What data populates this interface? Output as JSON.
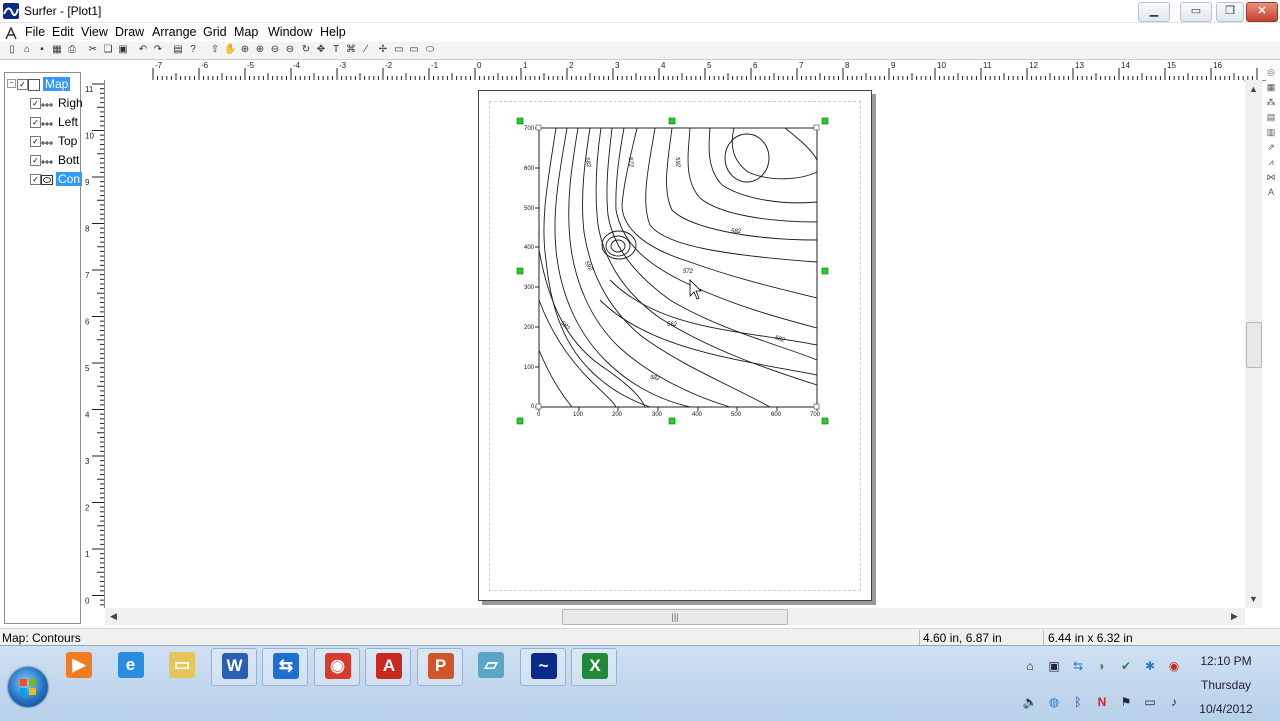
{
  "window": {
    "title": "Surfer - [Plot1]"
  },
  "menu": [
    "File",
    "Edit",
    "View",
    "Draw",
    "Arrange",
    "Grid",
    "Map",
    "Window",
    "Help"
  ],
  "object_manager": {
    "items": [
      {
        "label": "Map",
        "icon": "map-icon",
        "selected": true
      },
      {
        "label": "Righ",
        "icon": "axis-icon",
        "selected": false
      },
      {
        "label": "Left",
        "icon": "axis-icon",
        "selected": false
      },
      {
        "label": "Top",
        "icon": "axis-icon",
        "selected": false
      },
      {
        "label": "Bott",
        "icon": "axis-icon",
        "selected": false
      },
      {
        "label": "Con",
        "icon": "contour-layer-icon",
        "selected": true
      }
    ]
  },
  "rulers": {
    "horizontal": [
      "-7",
      "-6",
      "-5",
      "-4",
      "-3",
      "-2",
      "-1",
      "0",
      "1",
      "2",
      "3",
      "4",
      "5",
      "6",
      "7",
      "8",
      "9",
      "10",
      "11",
      "12",
      "13",
      "14",
      "15",
      "16"
    ],
    "vertical": [
      "11",
      "10",
      "9",
      "8",
      "7",
      "6",
      "5",
      "4",
      "3",
      "2",
      "1",
      "0"
    ]
  },
  "contour_map": {
    "y_axis_ticks": [
      "700",
      "600",
      "500",
      "400",
      "300",
      "200",
      "100",
      "0"
    ],
    "x_axis_ticks": [
      "0",
      "100",
      "200",
      "300",
      "400",
      "500",
      "600",
      "700"
    ],
    "contour_labels": [
      "582",
      "572",
      "592",
      "582",
      "592",
      "572",
      "582",
      "562",
      "582",
      "582"
    ]
  },
  "status_bar": {
    "selection": "Map: Contours",
    "position": "4.60 in, 6.87 in",
    "size": "6.44 in x 6.32 in"
  },
  "taskbar": {
    "apps": [
      {
        "name": "media-player-icon",
        "glyph": "▶",
        "color": "#f07c1e"
      },
      {
        "name": "internet-explorer-icon",
        "glyph": "e",
        "color": "#2a8ee0"
      },
      {
        "name": "file-explorer-icon",
        "glyph": "▭",
        "color": "#e8c45a"
      },
      {
        "name": "word-icon",
        "glyph": "W",
        "color": "#2b5fb4"
      },
      {
        "name": "teamviewer-icon",
        "glyph": "⇆",
        "color": "#1f6fd0"
      },
      {
        "name": "chrome-icon",
        "glyph": "◉",
        "color": "#d93a2b"
      },
      {
        "name": "acrobat-icon",
        "glyph": "A",
        "color": "#c8281e"
      },
      {
        "name": "powerpoint-icon",
        "glyph": "P",
        "color": "#d2552a"
      },
      {
        "name": "generic-app-icon",
        "glyph": "▱",
        "color": "#5aa6c9"
      },
      {
        "name": "surfer-icon",
        "glyph": "~",
        "color": "#0a2a8a"
      },
      {
        "name": "excel-icon",
        "glyph": "X",
        "color": "#1f8a3a"
      }
    ],
    "clock": {
      "time": "12:10 PM",
      "day": "Thursday",
      "date": "10/4/2012"
    }
  }
}
